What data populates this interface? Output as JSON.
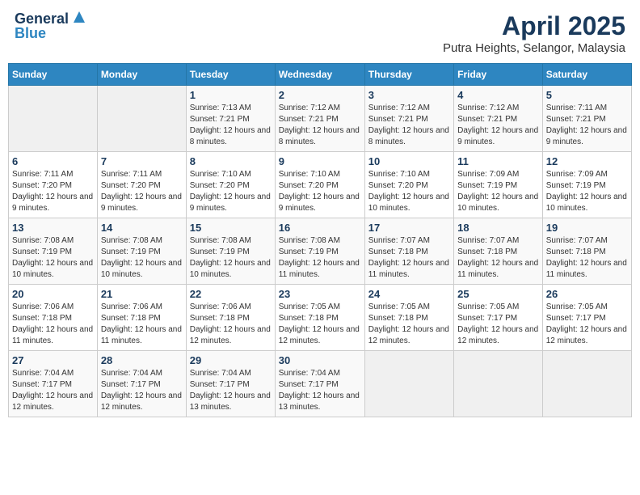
{
  "header": {
    "logo_line1": "General",
    "logo_line2": "Blue",
    "title": "April 2025",
    "subtitle": "Putra Heights, Selangor, Malaysia"
  },
  "calendar": {
    "days_of_week": [
      "Sunday",
      "Monday",
      "Tuesday",
      "Wednesday",
      "Thursday",
      "Friday",
      "Saturday"
    ],
    "weeks": [
      [
        {
          "day": "",
          "info": ""
        },
        {
          "day": "",
          "info": ""
        },
        {
          "day": "1",
          "info": "Sunrise: 7:13 AM\nSunset: 7:21 PM\nDaylight: 12 hours and 8 minutes."
        },
        {
          "day": "2",
          "info": "Sunrise: 7:12 AM\nSunset: 7:21 PM\nDaylight: 12 hours and 8 minutes."
        },
        {
          "day": "3",
          "info": "Sunrise: 7:12 AM\nSunset: 7:21 PM\nDaylight: 12 hours and 8 minutes."
        },
        {
          "day": "4",
          "info": "Sunrise: 7:12 AM\nSunset: 7:21 PM\nDaylight: 12 hours and 9 minutes."
        },
        {
          "day": "5",
          "info": "Sunrise: 7:11 AM\nSunset: 7:21 PM\nDaylight: 12 hours and 9 minutes."
        }
      ],
      [
        {
          "day": "6",
          "info": "Sunrise: 7:11 AM\nSunset: 7:20 PM\nDaylight: 12 hours and 9 minutes."
        },
        {
          "day": "7",
          "info": "Sunrise: 7:11 AM\nSunset: 7:20 PM\nDaylight: 12 hours and 9 minutes."
        },
        {
          "day": "8",
          "info": "Sunrise: 7:10 AM\nSunset: 7:20 PM\nDaylight: 12 hours and 9 minutes."
        },
        {
          "day": "9",
          "info": "Sunrise: 7:10 AM\nSunset: 7:20 PM\nDaylight: 12 hours and 9 minutes."
        },
        {
          "day": "10",
          "info": "Sunrise: 7:10 AM\nSunset: 7:20 PM\nDaylight: 12 hours and 10 minutes."
        },
        {
          "day": "11",
          "info": "Sunrise: 7:09 AM\nSunset: 7:19 PM\nDaylight: 12 hours and 10 minutes."
        },
        {
          "day": "12",
          "info": "Sunrise: 7:09 AM\nSunset: 7:19 PM\nDaylight: 12 hours and 10 minutes."
        }
      ],
      [
        {
          "day": "13",
          "info": "Sunrise: 7:08 AM\nSunset: 7:19 PM\nDaylight: 12 hours and 10 minutes."
        },
        {
          "day": "14",
          "info": "Sunrise: 7:08 AM\nSunset: 7:19 PM\nDaylight: 12 hours and 10 minutes."
        },
        {
          "day": "15",
          "info": "Sunrise: 7:08 AM\nSunset: 7:19 PM\nDaylight: 12 hours and 10 minutes."
        },
        {
          "day": "16",
          "info": "Sunrise: 7:08 AM\nSunset: 7:19 PM\nDaylight: 12 hours and 11 minutes."
        },
        {
          "day": "17",
          "info": "Sunrise: 7:07 AM\nSunset: 7:18 PM\nDaylight: 12 hours and 11 minutes."
        },
        {
          "day": "18",
          "info": "Sunrise: 7:07 AM\nSunset: 7:18 PM\nDaylight: 12 hours and 11 minutes."
        },
        {
          "day": "19",
          "info": "Sunrise: 7:07 AM\nSunset: 7:18 PM\nDaylight: 12 hours and 11 minutes."
        }
      ],
      [
        {
          "day": "20",
          "info": "Sunrise: 7:06 AM\nSunset: 7:18 PM\nDaylight: 12 hours and 11 minutes."
        },
        {
          "day": "21",
          "info": "Sunrise: 7:06 AM\nSunset: 7:18 PM\nDaylight: 12 hours and 11 minutes."
        },
        {
          "day": "22",
          "info": "Sunrise: 7:06 AM\nSunset: 7:18 PM\nDaylight: 12 hours and 12 minutes."
        },
        {
          "day": "23",
          "info": "Sunrise: 7:05 AM\nSunset: 7:18 PM\nDaylight: 12 hours and 12 minutes."
        },
        {
          "day": "24",
          "info": "Sunrise: 7:05 AM\nSunset: 7:18 PM\nDaylight: 12 hours and 12 minutes."
        },
        {
          "day": "25",
          "info": "Sunrise: 7:05 AM\nSunset: 7:17 PM\nDaylight: 12 hours and 12 minutes."
        },
        {
          "day": "26",
          "info": "Sunrise: 7:05 AM\nSunset: 7:17 PM\nDaylight: 12 hours and 12 minutes."
        }
      ],
      [
        {
          "day": "27",
          "info": "Sunrise: 7:04 AM\nSunset: 7:17 PM\nDaylight: 12 hours and 12 minutes."
        },
        {
          "day": "28",
          "info": "Sunrise: 7:04 AM\nSunset: 7:17 PM\nDaylight: 12 hours and 12 minutes."
        },
        {
          "day": "29",
          "info": "Sunrise: 7:04 AM\nSunset: 7:17 PM\nDaylight: 12 hours and 13 minutes."
        },
        {
          "day": "30",
          "info": "Sunrise: 7:04 AM\nSunset: 7:17 PM\nDaylight: 12 hours and 13 minutes."
        },
        {
          "day": "",
          "info": ""
        },
        {
          "day": "",
          "info": ""
        },
        {
          "day": "",
          "info": ""
        }
      ]
    ]
  }
}
